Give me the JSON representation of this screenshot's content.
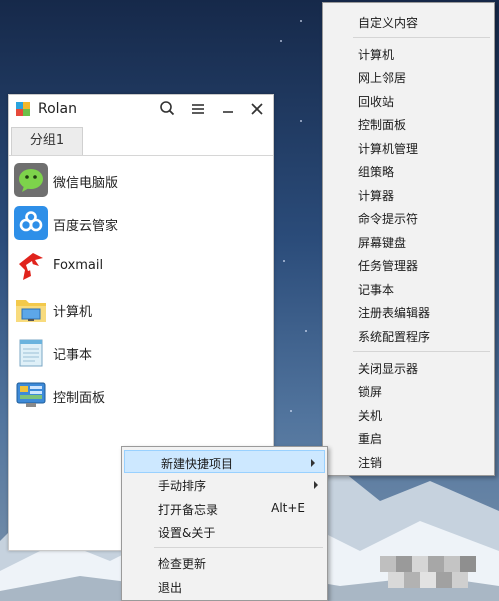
{
  "app": {
    "title": "Rolan",
    "group_tab": "分组1",
    "items": [
      {
        "label": "微信电脑版",
        "icon": "wechat-icon"
      },
      {
        "label": "百度云管家",
        "icon": "baidu-cloud-icon"
      },
      {
        "label": "Foxmail",
        "icon": "foxmail-icon"
      },
      {
        "label": "计算机",
        "icon": "computer-folder-icon"
      },
      {
        "label": "记事本",
        "icon": "notepad-icon"
      },
      {
        "label": "控制面板",
        "icon": "control-panel-icon"
      }
    ]
  },
  "custom_menu": {
    "header": "自定义内容",
    "group1": [
      "计算机",
      "网上邻居",
      "回收站",
      "控制面板",
      "计算机管理",
      "组策略",
      "计算器",
      "命令提示符",
      "屏幕键盘",
      "任务管理器",
      "记事本",
      "注册表编辑器",
      "系统配置程序"
    ],
    "group2": [
      "关闭显示器",
      "锁屏",
      "关机",
      "重启",
      "注销"
    ]
  },
  "popup_menu": {
    "new_shortcut": "新建快捷项目",
    "manual_sort": "手动排序",
    "open_memo": "打开备忘录",
    "open_memo_shortcut": "Alt+E",
    "settings_about": "设置&关于",
    "check_update": "检查更新",
    "exit": "退出"
  },
  "colors": {
    "menu_bg": "#f2f2f2",
    "menu_highlight": "#cde8ff",
    "window_bg": "#ffffff"
  }
}
